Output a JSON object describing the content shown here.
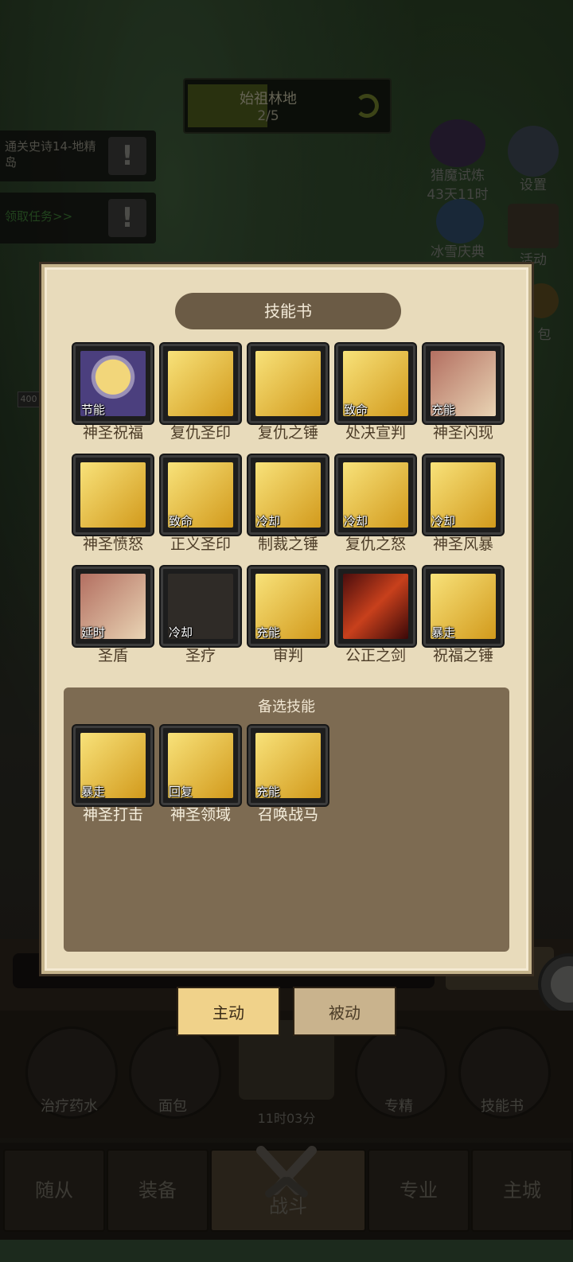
{
  "stage": {
    "name": "始祖林地",
    "progress": "2/5"
  },
  "quests": [
    {
      "text": "通关史诗14-地精岛"
    },
    {
      "text": "领取任务>>"
    }
  ],
  "side_buttons": {
    "trial_label": "猎魔试炼",
    "trial_timer": "43天11时",
    "settings_label": "设置",
    "ice_label": "冰雪庆典",
    "activity_label": "活动",
    "bag_label": "包"
  },
  "level_chip": "400",
  "skill_book": {
    "title": "技能书",
    "equipped": [
      {
        "name": "神圣祝福",
        "tag": "节能",
        "icon": "holy-helmet-icon"
      },
      {
        "name": "复仇圣印",
        "tag": "",
        "icon": "crossed-blades-icon"
      },
      {
        "name": "复仇之锤",
        "tag": "",
        "icon": "hammer-icon"
      },
      {
        "name": "处决宣判",
        "tag": "致命",
        "icon": "crown-strike-icon"
      },
      {
        "name": "神圣闪现",
        "tag": "充能",
        "icon": "burst-icon"
      },
      {
        "name": "神圣愤怒",
        "tag": "",
        "icon": "light-pillar-icon"
      },
      {
        "name": "正义圣印",
        "tag": "致命",
        "icon": "seal-icon"
      },
      {
        "name": "制裁之锤",
        "tag": "冷却",
        "icon": "hammer-icon"
      },
      {
        "name": "复仇之怒",
        "tag": "冷却",
        "icon": "hammer-icon"
      },
      {
        "name": "神圣风暴",
        "tag": "冷却",
        "icon": "sword-icon"
      },
      {
        "name": "圣盾",
        "tag": "延时",
        "icon": "shield-icon"
      },
      {
        "name": "圣疗",
        "tag": "冷却",
        "icon": "healing-hand-icon"
      },
      {
        "name": "审判",
        "tag": "充能",
        "icon": "judgment-hammer-icon"
      },
      {
        "name": "公正之剑",
        "tag": "",
        "icon": "flaming-sword-icon"
      },
      {
        "name": "祝福之锤",
        "tag": "暴走",
        "icon": "hammer-icon"
      }
    ],
    "alternate_title": "备选技能",
    "alternate": [
      {
        "name": "神圣打击",
        "tag": "暴走",
        "icon": "holy-strike-icon"
      },
      {
        "name": "神圣领域",
        "tag": "回复",
        "icon": "holy-crown-icon"
      },
      {
        "name": "召唤战马",
        "tag": "充能",
        "icon": "horse-icon"
      }
    ]
  },
  "toggles": {
    "active": "主动",
    "passive": "被动"
  },
  "hud": {
    "potion": "治疗药水",
    "bread": "面包",
    "timer": "11时03分",
    "specialty": "专精",
    "skillbook": "技能书"
  },
  "nav": {
    "followers": "随从",
    "equipment": "装备",
    "battle": "战斗",
    "profession": "专业",
    "city": "主城"
  },
  "colors": {
    "panel_bg": "#e8dbbb",
    "title_bar": "#6b5b45",
    "alt_bg": "#7d6b52",
    "toggle_active": "#f0d28a",
    "toggle_inactive": "#c9b38d"
  }
}
